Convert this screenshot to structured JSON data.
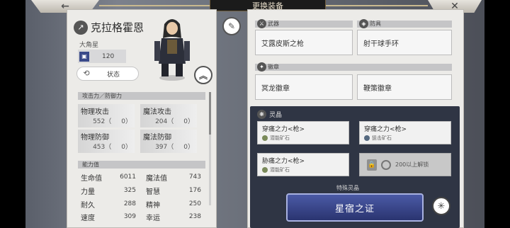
{
  "header": {
    "title": "更换装备",
    "back_icon": "←",
    "close_icon": "✕"
  },
  "character": {
    "name": "克拉格霍恩",
    "weapon_icon": "↗",
    "subtitle": "大角星",
    "level_label": "",
    "level": "120",
    "status_label": "状态"
  },
  "attack_defense": {
    "header": "攻击力／防御力",
    "phys_atk": {
      "label": "物理攻击",
      "value": "552（",
      "bonus": "0）"
    },
    "mag_atk": {
      "label": "魔法攻击",
      "value": "204（",
      "bonus": "0）"
    },
    "phys_def": {
      "label": "物理防御",
      "value": "453（",
      "bonus": "0）"
    },
    "mag_def": {
      "label": "魔法防御",
      "value": "397（",
      "bonus": "0）"
    }
  },
  "abilities": {
    "header": "能力值",
    "rows": [
      {
        "l1": "生命值",
        "v1": "6011",
        "l2": "魔法值",
        "v2": "743"
      },
      {
        "l1": "力量",
        "v1": "325",
        "l2": "智慧",
        "v2": "176"
      },
      {
        "l1": "耐久",
        "v1": "288",
        "l2": "精神",
        "v2": "250"
      },
      {
        "l1": "速度",
        "v1": "309",
        "l2": "幸运",
        "v2": "238"
      }
    ]
  },
  "equipment": {
    "weapon_header": "武器",
    "weapon": "艾露皮斯之枪",
    "armor_header": "防具",
    "armor": "射干球手环",
    "emblem_header": "徽章",
    "emblem1": "冥龙徽章",
    "emblem2": "鞭策徽章"
  },
  "crystals": {
    "header": "灵晶",
    "c1": {
      "name": "穿痛之力<枪>",
      "sub": "潜能矿石"
    },
    "c2": {
      "name": "穿痛之力<枪>",
      "sub": "狙击矿石"
    },
    "c3": {
      "name": "胁痛之力<枪>",
      "sub": "潜能矿石"
    },
    "unlock": "200以上解锁",
    "special_label": "特殊灵晶",
    "star_button": "星宿之证"
  }
}
